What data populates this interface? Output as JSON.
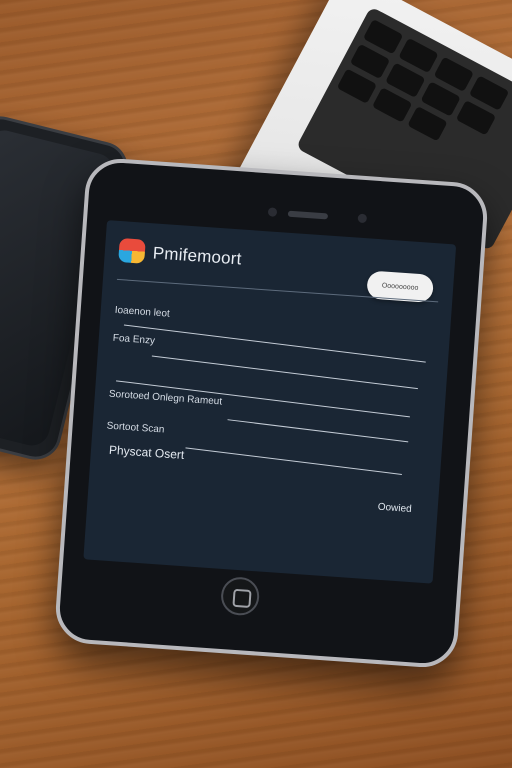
{
  "app": {
    "title": "Pmifemoort"
  },
  "header": {
    "button_label": "Ooooooooo"
  },
  "form": {
    "fields": [
      {
        "label": "Ioaenon leot"
      },
      {
        "label": "Foa Enzy"
      },
      {
        "label": ""
      },
      {
        "label": "Sorotoed Onlegn Rameut"
      },
      {
        "label": "Sortoot Scan"
      }
    ],
    "submit_label": "Physcat Osert",
    "action_link": "Oowied"
  }
}
